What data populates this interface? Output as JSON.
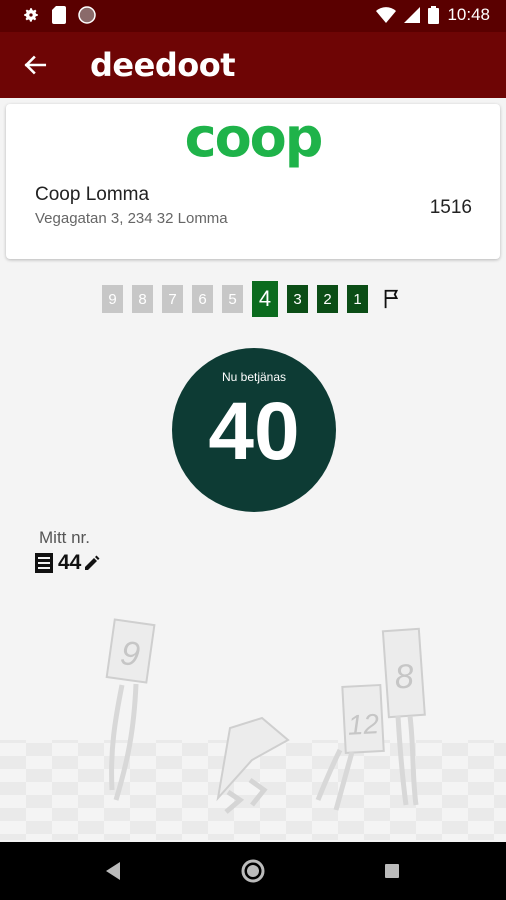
{
  "status_bar": {
    "time": "10:48",
    "icons": [
      "gear-icon",
      "sd-card-icon",
      "circle-icon",
      "wifi-icon",
      "signal-icon",
      "battery-icon"
    ]
  },
  "app_bar": {
    "title": "deedoot",
    "back_icon": "arrow-left-icon",
    "background": "#6e0505"
  },
  "store": {
    "logo_text": "coop",
    "logo_color": "#1fb34a",
    "name": "Coop Lomma",
    "address": "Vegagatan 3, 234 32 Lomma",
    "id": "1516"
  },
  "queue": {
    "numbers": [
      "9",
      "8",
      "7",
      "6",
      "5",
      "4",
      "3",
      "2",
      "1"
    ],
    "current_index": 5,
    "end_icon": "flag-icon"
  },
  "serving": {
    "caption": "Nu betjänas",
    "number": "40",
    "color": "#0d3b34"
  },
  "my_ticket": {
    "label": "Mitt nr.",
    "number": "44",
    "ticket_icon": "ticket-icon",
    "edit_icon": "pencil-icon"
  },
  "illustration": {
    "cards": [
      "9",
      "12",
      "8"
    ]
  },
  "nav_bar": {
    "icons": [
      "back-triangle-icon",
      "home-circle-icon",
      "recents-square-icon"
    ]
  }
}
